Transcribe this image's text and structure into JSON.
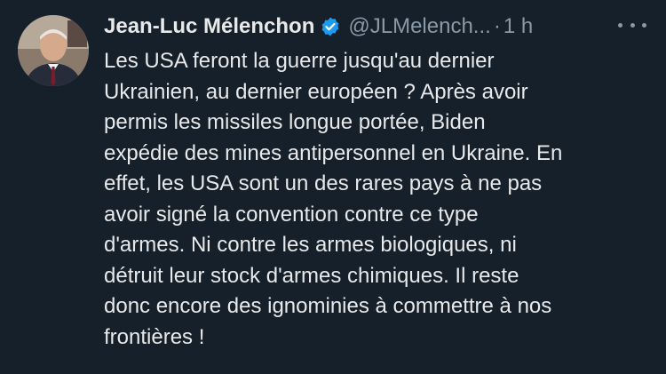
{
  "tweet": {
    "author": {
      "display_name": "Jean-Luc Mélenchon",
      "handle": "@JLMelench...",
      "verified": true
    },
    "separator": "·",
    "timestamp": "1 h",
    "text": "Les USA feront la guerre jusqu'au dernier\nUkrainien, au dernier européen ? Après avoir\npermis les missiles longue portée, Biden\nexpédie des mines antipersonnel en Ukraine. En\neffet, les USA sont un des rares pays à ne pas\navoir signé la convention contre ce type\nd'armes. Ni contre les armes biologiques, ni\ndétruit leur stock d'armes chimiques. Il reste\ndonc encore des ignominies à commettre à nos\nfrontières !"
  },
  "icons": {
    "verified": "verified-badge-icon",
    "more": "more-options-icon"
  },
  "colors": {
    "background": "#15202b",
    "text_primary": "#e7e9ea",
    "text_secondary": "#8b98a5",
    "verified_blue": "#1d9bf0"
  }
}
